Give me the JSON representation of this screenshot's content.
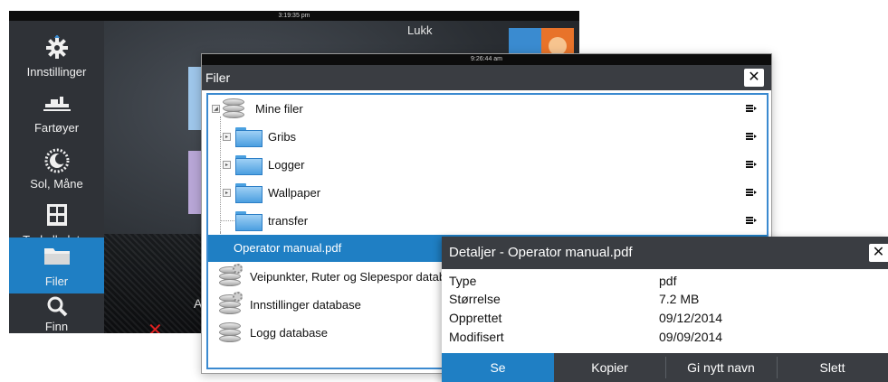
{
  "background": {
    "status_time": "3:19:35 pm",
    "close_label": "Lukk",
    "partial_label": "Au",
    "sidebar": [
      {
        "label": "Innstillinger",
        "icon": "gear-icon"
      },
      {
        "label": "Fartøyer",
        "icon": "ship-icon"
      },
      {
        "label": "Sol, Måne",
        "icon": "sun-moon-icon"
      },
      {
        "label": "Turkalkulator",
        "icon": "calculator-icon"
      },
      {
        "label": "Filer",
        "icon": "folder-icon",
        "active": true
      },
      {
        "label": "Finn",
        "icon": "search-icon"
      }
    ]
  },
  "filer": {
    "status_time": "9:26:44 am",
    "title": "Filer",
    "close_glyph": "✕",
    "menu_icon": "list-menu-icon",
    "items": [
      {
        "label": "Mine filer",
        "type": "database",
        "expander": "◢"
      },
      {
        "label": "Gribs",
        "type": "folder",
        "expander": "▸"
      },
      {
        "label": "Logger",
        "type": "folder",
        "expander": "▸"
      },
      {
        "label": "Wallpaper",
        "type": "folder",
        "expander": "▸"
      },
      {
        "label": "transfer",
        "type": "folder"
      },
      {
        "label": "Operator manual.pdf",
        "type": "file",
        "selected": true
      },
      {
        "label": "Veipunkter, Ruter og Slepespor database",
        "type": "database-gear"
      },
      {
        "label": "Innstillinger database",
        "type": "database-gear"
      },
      {
        "label": "Logg database",
        "type": "database"
      }
    ]
  },
  "details": {
    "title": "Detaljer - Operator manual.pdf",
    "close_glyph": "✕",
    "rows": [
      {
        "key": "Type",
        "value": "pdf"
      },
      {
        "key": "Størrelse",
        "value": "7.2 MB"
      },
      {
        "key": "Opprettet",
        "value": "09/12/2014"
      },
      {
        "key": "Modifisert",
        "value": "09/09/2014"
      }
    ],
    "actions": [
      "Se",
      "Kopier",
      "Gi nytt navn",
      "Slett"
    ],
    "active_action": "Se",
    "colors": {
      "accent": "#1f7fc4",
      "header": "#3a3d42"
    }
  }
}
